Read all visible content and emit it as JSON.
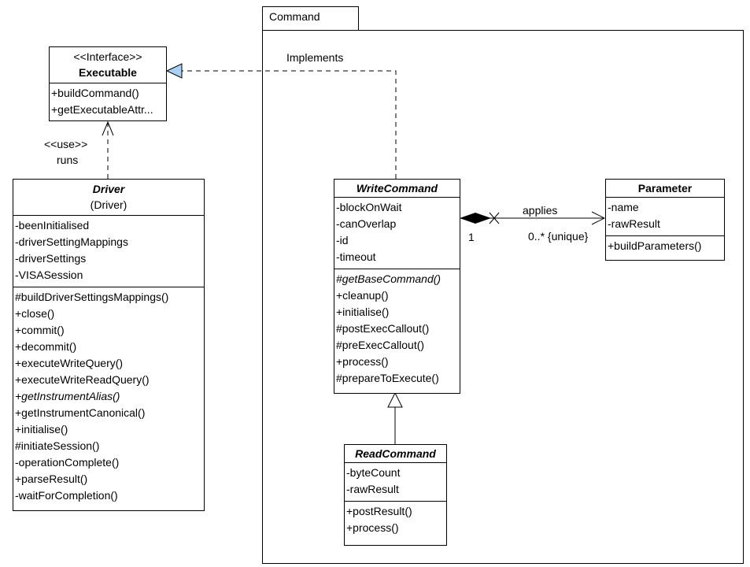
{
  "package": {
    "name": "Command"
  },
  "executable": {
    "stereotype": "<<Interface>>",
    "name": "Executable",
    "methods": [
      "+buildCommand()",
      "+getExecutableAttr..."
    ]
  },
  "driver": {
    "name": "Driver",
    "subtitle": "(Driver)",
    "attributes": [
      "-beenInitialised",
      "-driverSettingMappings",
      "-driverSettings",
      "-VISASession"
    ],
    "methods": [
      "#buildDriverSettingsMappings()",
      "+close()",
      "+commit()",
      "+decommit()",
      "+executeWriteQuery()",
      "+executeWriteReadQuery()",
      "+getInstrumentAlias()",
      "+getInstrumentCanonical()",
      "+initialise()",
      "#initiateSession()",
      "-operationComplete()",
      "+parseResult()",
      "-waitForCompletion()"
    ]
  },
  "write_command": {
    "name": "WriteCommand",
    "attributes": [
      "-blockOnWait",
      "-canOverlap",
      "-id",
      "-timeout"
    ],
    "methods": [
      "#getBaseCommand()",
      "+cleanup()",
      "+initialise()",
      "#postExecCallout()",
      "#preExecCallout()",
      "+process()",
      "#prepareToExecute()"
    ]
  },
  "parameter": {
    "name": "Parameter",
    "attributes": [
      "-name",
      "-rawResult"
    ],
    "methods": [
      "+buildParameters()"
    ]
  },
  "read_command": {
    "name": "ReadCommand",
    "attributes": [
      "-byteCount",
      "-rawResult"
    ],
    "methods": [
      "+postResult()",
      "+process()"
    ]
  },
  "relations": {
    "implements": "Implements",
    "use_stereotype": "<<use>>",
    "use_label": "runs",
    "applies": "applies",
    "mult_source": "1",
    "mult_target": "0..* {unique}"
  },
  "colors": {
    "realization_arrow_fill": "#a9d1f5"
  }
}
